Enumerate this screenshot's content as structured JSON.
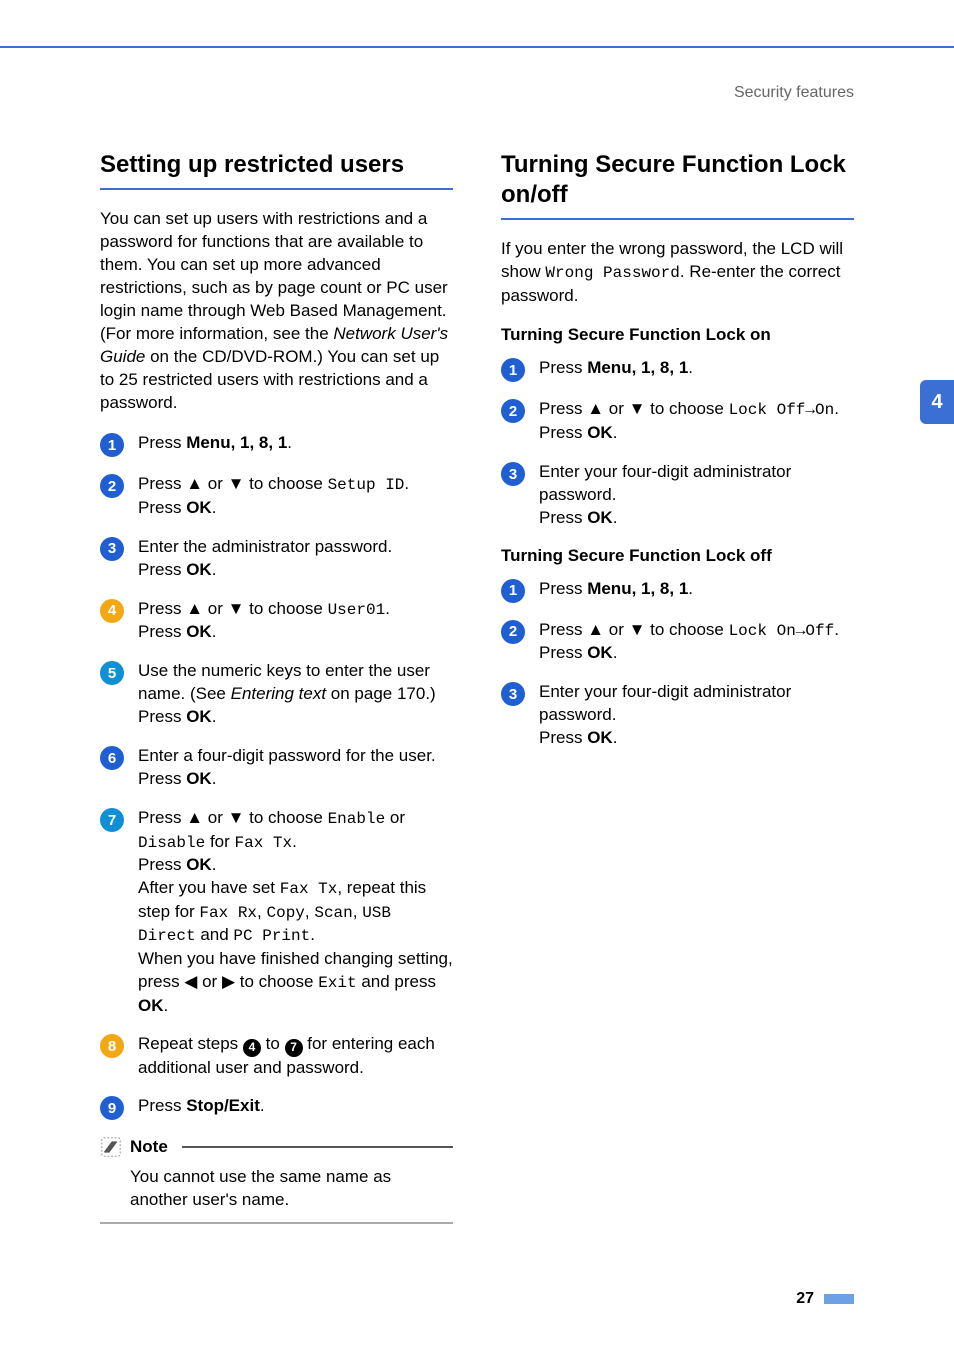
{
  "header": {
    "breadcrumb": "Security features"
  },
  "side_tab": "4",
  "left": {
    "title": "Setting up restricted users",
    "intro_pre": "You can set up users with restrictions and a password for functions that are available to them. You can set up more advanced restrictions, such as by page count or PC user login name through Web Based Management. (For more information, see the ",
    "intro_em": "Network User's Guide",
    "intro_post": " on the CD/DVD-ROM.) You can set up to 25 restricted users with restrictions and a password.",
    "steps": {
      "s1_pre": "Press ",
      "s1_menu": "Menu",
      "s1_seq": ", 1, 8, 1",
      "s1_end": ".",
      "s2_pre": "Press ",
      "s2_mid": " to choose ",
      "s2_mono": "Setup ID",
      "s2_dot": ".",
      "s2_press": "Press ",
      "s2_ok": "OK",
      "s2_end": ".",
      "s3_line1": "Enter the administrator password.",
      "s3_press": "Press ",
      "s3_ok": "OK",
      "s3_end": ".",
      "s4_pre": "Press ",
      "s4_mid": " to choose ",
      "s4_mono": "User01",
      "s4_dot": ".",
      "s4_press": "Press ",
      "s4_ok": "OK",
      "s4_end": ".",
      "s5_pre": "Use the numeric keys to enter the user name. (See ",
      "s5_em": "Entering text",
      "s5_post": " on page 170.)",
      "s5_press": "Press ",
      "s5_ok": "OK",
      "s5_end": ".",
      "s6_line1": "Enter a four-digit password for the user.",
      "s6_press": "Press ",
      "s6_ok": "OK",
      "s6_end": ".",
      "s7_pre": "Press ",
      "s7_mid": " to choose ",
      "s7_m1": "Enable",
      "s7_or": " or ",
      "s7_m2": "Disable",
      "s7_for": " for ",
      "s7_m3": "Fax Tx",
      "s7_dot": ".",
      "s7_press": "Press ",
      "s7_ok": "OK",
      "s7_end": ".",
      "s7_after1": "After you have set ",
      "s7_m4": "Fax Tx",
      "s7_after2": ", repeat this step for ",
      "s7_m5": "Fax Rx",
      "s7_c1": ", ",
      "s7_m6": "Copy",
      "s7_c2": ", ",
      "s7_m7": "Scan",
      "s7_c3": ", ",
      "s7_m8": "USB Direct",
      "s7_and": " and ",
      "s7_m9": "PC Print",
      "s7_dot2": ".",
      "s7_fin1": "When you have finished changing setting, press ",
      "s7_fin_or": " or ",
      "s7_fin2": " to choose ",
      "s7_m10": "Exit",
      "s7_fin3": " and press ",
      "s7_ok2": "OK",
      "s7_fin4": ".",
      "s8_pre": "Repeat steps ",
      "s8_ref1": "4",
      "s8_mid": " to ",
      "s8_ref2": "7",
      "s8_post": " for entering each additional user and password.",
      "s9_pre": "Press ",
      "s9_btn": "Stop/Exit",
      "s9_end": "."
    },
    "note": {
      "label": "Note",
      "body": "You cannot use the same name as another user's name."
    }
  },
  "right": {
    "title": "Turning Secure Function Lock on/off",
    "intro_pre": "If you enter the wrong password, the LCD will show ",
    "intro_mono": "Wrong Password",
    "intro_post": ". Re-enter the correct password.",
    "sub_on": "Turning Secure Function Lock on",
    "on_steps": {
      "s1_pre": "Press ",
      "s1_menu": "Menu",
      "s1_seq": ", 1, 8, 1",
      "s1_end": ".",
      "s2_pre": "Press ",
      "s2_mid": " to choose ",
      "s2_mono": "Lock Off→On",
      "s2_dot": ".",
      "s2_press": "Press ",
      "s2_ok": "OK",
      "s2_end": ".",
      "s3_line1": "Enter your four-digit administrator password.",
      "s3_press": "Press ",
      "s3_ok": "OK",
      "s3_end": "."
    },
    "sub_off": "Turning Secure Function Lock off",
    "off_steps": {
      "s1_pre": "Press ",
      "s1_menu": "Menu",
      "s1_seq": ", 1, 8, 1",
      "s1_end": ".",
      "s2_pre": "Press ",
      "s2_mid": " to choose ",
      "s2_mono": "Lock On→Off",
      "s2_dot": ".",
      "s2_press": "Press ",
      "s2_ok": "OK",
      "s2_end": ".",
      "s3_line1": "Enter your four-digit administrator password.",
      "s3_press": "Press ",
      "s3_ok": "OK",
      "s3_end": "."
    }
  },
  "footer": {
    "page": "27"
  },
  "symbols": {
    "up": "▲",
    "down": "▼",
    "or": " or ",
    "left": "◀",
    "right": "▶"
  },
  "colors": {
    "c1": "#1f5fd1",
    "c2": "#1f5fd1",
    "c3": "#1f5fd1",
    "c4": "#f2a814",
    "c5": "#0f8fd6",
    "c6": "#1f5fd1",
    "c7": "#0f8fd6",
    "c8": "#f2a814",
    "c9": "#1f5fd1"
  }
}
